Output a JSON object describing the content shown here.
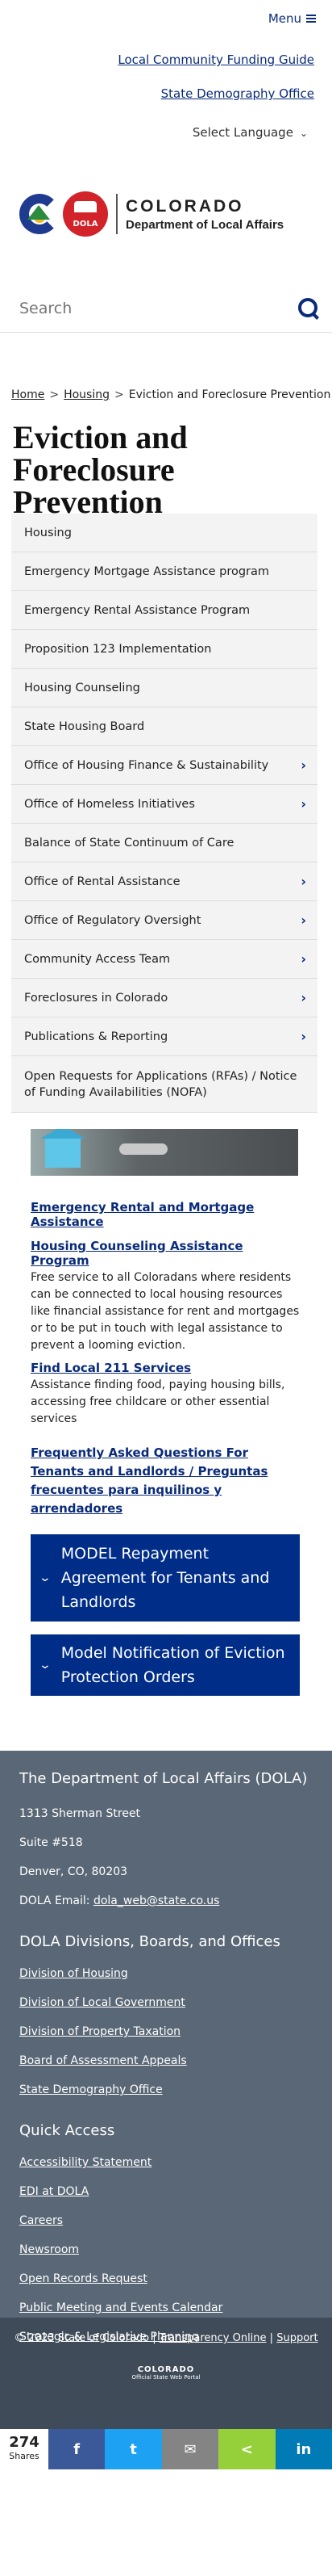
{
  "header": {
    "menu_label": "Menu",
    "utility_links": [
      "Local Community Funding Guide",
      "State Demography Office"
    ],
    "language": "Select Language",
    "brand_line1": "COLORADO",
    "brand_line2": "Department of Local Affairs",
    "logo_badge": "DOLA",
    "search_placeholder": "Search"
  },
  "breadcrumb": {
    "home": "Home",
    "housing": "Housing",
    "current": "Eviction and Foreclosure Prevention",
    "sep": ">"
  },
  "page_title": "Eviction and Foreclosure Prevention",
  "sidenav": [
    {
      "label": "Housing",
      "chevron": ""
    },
    {
      "label": "Emergency Mortgage Assistance program",
      "chevron": ""
    },
    {
      "label": "Emergency Rental Assistance Program",
      "chevron": ""
    },
    {
      "label": "Proposition 123 Implementation",
      "chevron": ""
    },
    {
      "label": "Housing Counseling",
      "chevron": ""
    },
    {
      "label": "State Housing Board",
      "chevron": ""
    },
    {
      "label": "Office of Housing Finance & Sustainability",
      "chevron": "›"
    },
    {
      "label": "Office of Homeless Initiatives",
      "chevron": "›"
    },
    {
      "label": "Balance of State Continuum of Care",
      "chevron": ""
    },
    {
      "label": "Office of Rental Assistance",
      "chevron": "›"
    },
    {
      "label": "Office of Regulatory Oversight",
      "chevron": "›"
    },
    {
      "label": "Community Access Team",
      "chevron": "›"
    },
    {
      "label": "Foreclosures in Colorado",
      "chevron": "›"
    },
    {
      "label": "Publications & Reporting",
      "chevron": "›"
    },
    {
      "label": "Open Requests for Applications (RFAs) / Notice of Funding Availabilities (NOFA)",
      "chevron": ""
    }
  ],
  "content": {
    "emergency_link": "Emergency Rental and Mortgage Assistance",
    "hca_link": "Housing Counseling Assistance Program",
    "hca_text": "Free service to all Coloradans where residents can be connected to local housing resources like financial assistance for rent and mortgages or to be put in touch with legal assistance to prevent a looming eviction.",
    "local211_link": "Find Local 211 Services",
    "local211_text": "Assistance finding food, paying housing bills, accessing free childcare or other essential services",
    "faq_link": "Frequently Asked Questions For Tenants and Landlords / Preguntas frecuentes para inquilinos y arrendadores",
    "accordion_1": "MODEL Repayment Agreement for Tenants and Landlords",
    "accordion_2": "Model Notification of Eviction Protection Orders"
  },
  "footer": {
    "dept_title": "The Department of Local Affairs (DOLA)",
    "address1": "1313 Sherman Street",
    "address2": "Suite  #518",
    "address3": "Denver, CO, 80203",
    "email_label": "DOLA Email:",
    "email": "dola_web@state.co.us",
    "divisions_title": "DOLA Divisions, Boards, and Offices",
    "divisions": [
      "Division of Housing",
      "Division of Local Government",
      "Division of Property Taxation",
      "Board of Assessment Appeals",
      "State Demography Office"
    ],
    "quick_title": "Quick Access",
    "quick": [
      "Accessibility Statement",
      "EDI at DOLA",
      "Careers",
      "Newsroom",
      "Open Records Request",
      "Public Meeting and Events Calendar",
      "Strategic & Legislative Planning"
    ]
  },
  "bottom": {
    "copyright": "© 2023 State of Colorado",
    "sep": "|",
    "transparency": "Transparency Online",
    "support": "Support",
    "portal_name": "COLORADO",
    "portal_sub": "Official State Web Portal"
  },
  "share": {
    "count": "274",
    "label": "Shares",
    "buttons": [
      {
        "icon": "f",
        "color": "#3b5998"
      },
      {
        "icon": "t",
        "color": "#1da1f2"
      },
      {
        "icon": "✉",
        "color": "#848484"
      },
      {
        "icon": "<",
        "color": "#95d03a"
      },
      {
        "icon": "in",
        "color": "#007bb5"
      }
    ]
  }
}
